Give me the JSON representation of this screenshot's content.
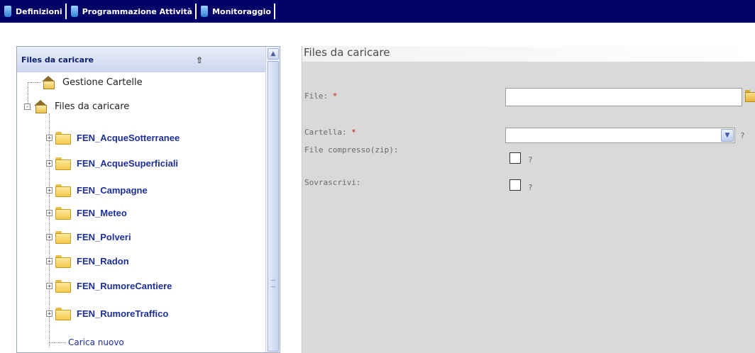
{
  "menu": {
    "items": [
      {
        "label": "Definizioni"
      },
      {
        "label": "Programmazione Attività"
      },
      {
        "label": "Monitoraggio"
      }
    ]
  },
  "sidebar": {
    "title": "Files da caricare",
    "root_items": [
      {
        "label": "Gestione Cartelle"
      },
      {
        "label": "Files da caricare"
      }
    ],
    "folders": [
      {
        "label": "FEN_AcqueSotterranee"
      },
      {
        "label": "FEN_AcqueSuperficiali"
      },
      {
        "label": "FEN_Campagne"
      },
      {
        "label": "FEN_Meteo"
      },
      {
        "label": "FEN_Polveri"
      },
      {
        "label": "FEN_Radon"
      },
      {
        "label": "FEN_RumoreCantiere"
      },
      {
        "label": "FEN_RumoreTraffico"
      }
    ],
    "upload_new": "Carica nuovo"
  },
  "form": {
    "title": "Files da caricare",
    "file_label": "File:",
    "folder_label": "Cartella:",
    "required_mark": "*",
    "compressed_label": "File compresso(zip):",
    "overwrite_label": "Sovrascrivi:",
    "help_mark": "?",
    "file_value": "",
    "folder_value": "",
    "compressed_checked": false,
    "overwrite_checked": false
  },
  "colors": {
    "menubar": "#000066",
    "form_bg": "#d9d9d9",
    "tree_link": "#1c2f9b",
    "required": "#d01010"
  }
}
